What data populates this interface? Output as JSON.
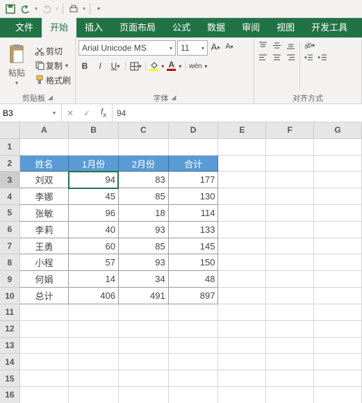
{
  "qat": {
    "save": "save-icon",
    "undo": "undo-icon",
    "redo": "redo-icon",
    "print": "print-preview-icon"
  },
  "tabs": [
    "文件",
    "开始",
    "插入",
    "页面布局",
    "公式",
    "数据",
    "审阅",
    "视图",
    "开发工具"
  ],
  "active_tab": 1,
  "clipboard": {
    "paste": "粘贴",
    "cut": "剪切",
    "copy": "复制",
    "format_painter": "格式刷",
    "group": "剪贴板"
  },
  "font": {
    "name": "Arial Unicode MS",
    "size": "11",
    "group": "字体",
    "wen": "wén"
  },
  "align": {
    "group": "对齐方式"
  },
  "namebox": "B3",
  "formula_value": "94",
  "cols": [
    "A",
    "B",
    "C",
    "D",
    "E",
    "F",
    "G"
  ],
  "rows": [
    "1",
    "2",
    "3",
    "4",
    "5",
    "6",
    "7",
    "8",
    "9",
    "10",
    "11",
    "12",
    "13",
    "14",
    "15",
    "16"
  ],
  "headers": [
    "姓名",
    "1月份",
    "2月份",
    "合计"
  ],
  "data_rows": [
    {
      "n": "刘双",
      "a": "94",
      "b": "83",
      "c": "177"
    },
    {
      "n": "李娜",
      "a": "45",
      "b": "85",
      "c": "130"
    },
    {
      "n": "张敏",
      "a": "96",
      "b": "18",
      "c": "114"
    },
    {
      "n": "李莉",
      "a": "40",
      "b": "93",
      "c": "133"
    },
    {
      "n": "王勇",
      "a": "60",
      "b": "85",
      "c": "145"
    },
    {
      "n": "小程",
      "a": "57",
      "b": "93",
      "c": "150"
    },
    {
      "n": "何娟",
      "a": "14",
      "b": "34",
      "c": "48"
    },
    {
      "n": "总计",
      "a": "406",
      "b": "491",
      "c": "897"
    }
  ],
  "selected_cell": {
    "row": 3,
    "col": "B"
  },
  "colors": {
    "ribbon_green": "#217346",
    "table_header": "#5B9BD5",
    "font_red": "#C00000",
    "fill_yellow": "#FFFF00"
  }
}
